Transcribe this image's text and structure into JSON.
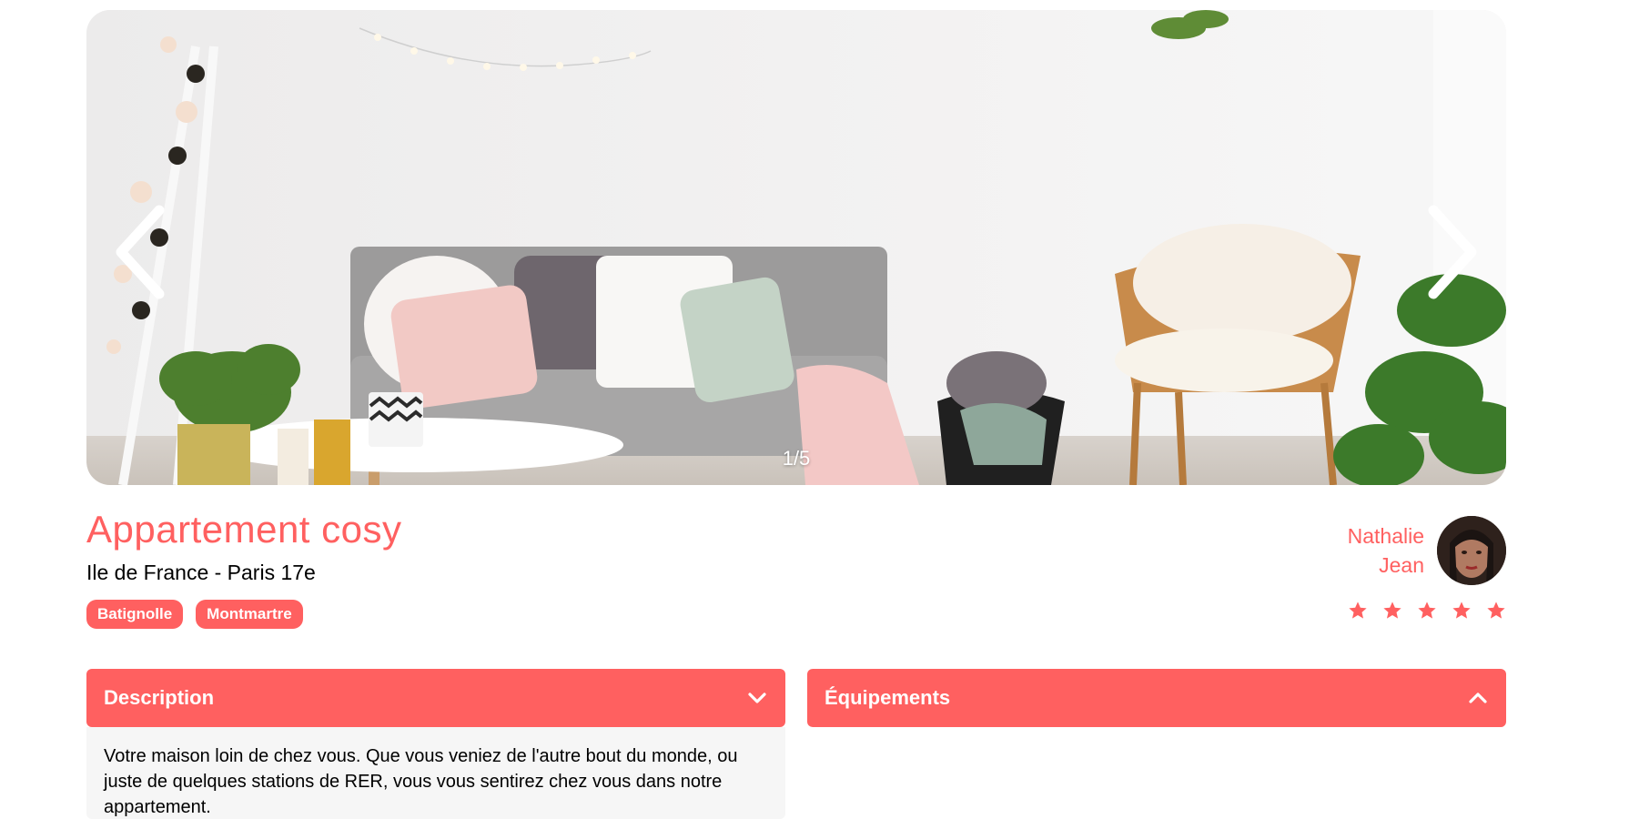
{
  "gallery": {
    "counter": "1/5",
    "current": 1,
    "total": 5
  },
  "listing": {
    "title": "Appartement cosy",
    "location": "Ile de France - Paris 17e",
    "tags": [
      "Batignolle",
      "Montmartre"
    ]
  },
  "host": {
    "first_name": "Nathalie",
    "last_name": "Jean",
    "rating": 5,
    "rating_max": 5
  },
  "collapses": {
    "description": {
      "label": "Description",
      "expanded": true,
      "text": "Votre maison loin de chez vous. Que vous veniez de l'autre bout du monde, ou juste de quelques stations de RER, vous vous sentirez chez vous dans notre appartement."
    },
    "equipments": {
      "label": "Équipements",
      "expanded": false
    }
  },
  "colors": {
    "accent": "#ff6060",
    "panel_bg": "#f6f6f6",
    "star_active": "#ff6060",
    "star_inactive": "#e3e3e3"
  },
  "icons": {
    "prev": "chevron-left-icon",
    "next": "chevron-right-icon",
    "star": "star-icon",
    "collapse_open": "chevron-down-icon",
    "collapse_closed": "chevron-up-icon"
  }
}
